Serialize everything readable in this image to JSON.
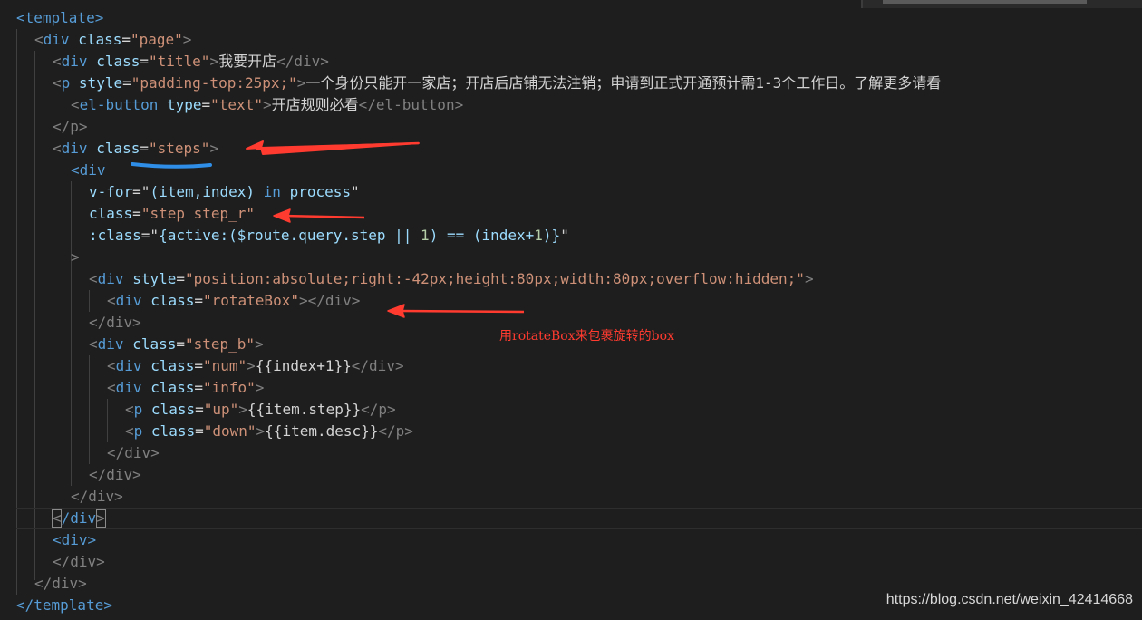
{
  "editor": {
    "code": {
      "l1": "<template>",
      "l2_tag": "div",
      "l2_attr": "class",
      "l2_val": "\"page\"",
      "l3_tag": "div",
      "l3_attr": "class",
      "l3_val": "\"title\"",
      "l3_text": "我要开店",
      "l3_close": "</div>",
      "l4_tag": "p",
      "l4_attr": "style",
      "l4_val": "\"padding-top:25px;\"",
      "l4_text": "一个身份只能开一家店；开店后店铺无法注销；申请到正式开通预计需1-3个工作日。了解更多请看",
      "l5_tag": "el-button",
      "l5_attr": "type",
      "l5_val": "\"text\"",
      "l5_text": "开店规则必看",
      "l5_close": "</el-button>",
      "l6": "</p>",
      "l7_tag": "div",
      "l7_attr": "class",
      "l7_val": "\"steps\"",
      "l8": "<div",
      "l9_attr": "v-for",
      "l9_a": "(item,index) ",
      "l9_in": "in",
      "l9_b": " process",
      "l10_attr": "class",
      "l10_val": "\"step step_r\"",
      "l11_attr": ":class",
      "l11_a": "{active:($route.query.step || ",
      "l11_n1": "1",
      "l11_b": ") == (index+",
      "l11_n2": "1",
      "l11_c": ")}",
      "l12": ">",
      "l13_tag": "div",
      "l13_attr": "style",
      "l13_val": "\"position:absolute;right:-42px;height:80px;width:80px;overflow:hidden;\"",
      "l14_tag": "div",
      "l14_attr": "class",
      "l14_val": "\"rotateBox\"",
      "l14_close": "</div>",
      "l15": "</div>",
      "l16_tag": "div",
      "l16_attr": "class",
      "l16_val": "\"step_b\"",
      "l17_tag": "div",
      "l17_attr": "class",
      "l17_val": "\"num\"",
      "l17_text": "{{index+1}}",
      "l17_close": "</div>",
      "l18_tag": "div",
      "l18_attr": "class",
      "l18_val": "\"info\"",
      "l19_tag": "p",
      "l19_attr": "class",
      "l19_val": "\"up\"",
      "l19_text": "{{item.step}}",
      "l19_close": "</p>",
      "l20_tag": "p",
      "l20_attr": "class",
      "l20_val": "\"down\"",
      "l20_text": "{{item.desc}}",
      "l20_close": "</p>",
      "l21": "</div>",
      "l22": "</div>",
      "l23": "</div>",
      "l24_open": "<",
      "l24_mid": "/div",
      "l24_close": ">",
      "l25": "<div>",
      "l26": "</div>",
      "l27": "</div>",
      "l28": "</template>"
    }
  },
  "annotation": {
    "note": "用rotateBox来包裹旋转的box",
    "arrow_color": "#ff3b30",
    "underline_color": "#2f8fe8"
  },
  "watermark": "https://blog.csdn.net/weixin_42414668"
}
